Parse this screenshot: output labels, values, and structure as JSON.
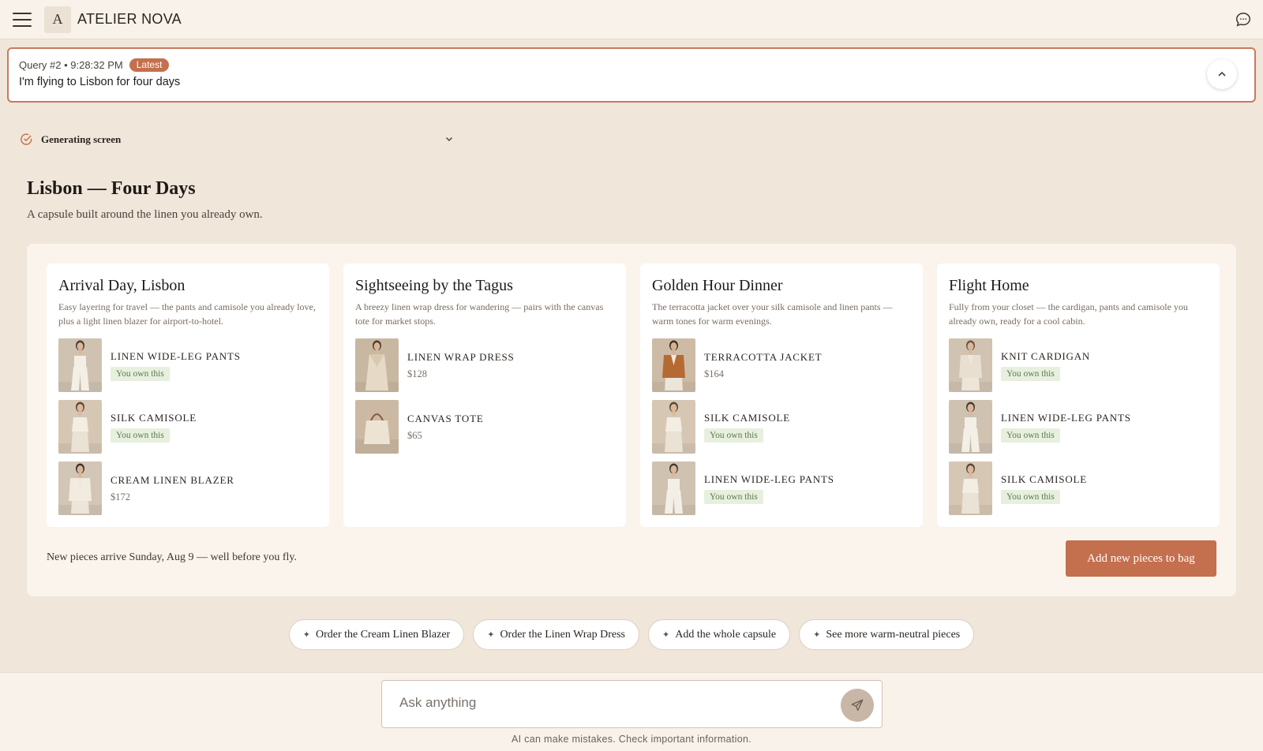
{
  "app": {
    "brand": "ATELIER NOVA",
    "logo_letter": "A"
  },
  "query": {
    "meta": "Query #2 • 9:28:32 PM",
    "badge": "Latest",
    "text": "I'm flying to Lisbon for four days"
  },
  "status": {
    "label": "Generating screen"
  },
  "page": {
    "title": "Lisbon — Four Days",
    "subtitle": "A capsule built around the linen you already own."
  },
  "days": [
    {
      "title": "Arrival Day, Lisbon",
      "description": "Easy layering for travel — the pants and camisole you already love, plus a light linen blazer for airport-to-hotel.",
      "items": [
        {
          "name": "LINEN WIDE-LEG PANTS",
          "owned": "You own this",
          "image": "pants"
        },
        {
          "name": "SILK CAMISOLE",
          "owned": "You own this",
          "image": "camisole"
        },
        {
          "name": "CREAM LINEN BLAZER",
          "price": "$172",
          "image": "blazer"
        }
      ]
    },
    {
      "title": "Sightseeing by the Tagus",
      "description": "A breezy linen wrap dress for wandering — pairs with the canvas tote for market stops.",
      "items": [
        {
          "name": "LINEN WRAP DRESS",
          "price": "$128",
          "image": "dress"
        },
        {
          "name": "CANVAS TOTE",
          "price": "$65",
          "image": "tote"
        }
      ]
    },
    {
      "title": "Golden Hour Dinner",
      "description": "The terracotta jacket over your silk camisole and linen pants — warm tones for warm evenings.",
      "items": [
        {
          "name": "TERRACOTTA JACKET",
          "price": "$164",
          "image": "jacket"
        },
        {
          "name": "SILK CAMISOLE",
          "owned": "You own this",
          "image": "camisole"
        },
        {
          "name": "LINEN WIDE-LEG PANTS",
          "owned": "You own this",
          "image": "pants"
        }
      ]
    },
    {
      "title": "Flight Home",
      "description": "Fully from your closet — the cardigan, pants and camisole you already own, ready for a cool cabin.",
      "items": [
        {
          "name": "KNIT CARDIGAN",
          "owned": "You own this",
          "image": "cardigan"
        },
        {
          "name": "LINEN WIDE-LEG PANTS",
          "owned": "You own this",
          "image": "pants"
        },
        {
          "name": "SILK CAMISOLE",
          "owned": "You own this",
          "image": "camisole"
        }
      ]
    }
  ],
  "footer_note": "New pieces arrive Sunday, Aug 9 — well before you fly.",
  "bag_button": "Add new pieces to bag",
  "suggestions": [
    "Order the Cream Linen Blazer",
    "Order the Linen Wrap Dress",
    "Add the whole capsule",
    "See more warm-neutral pieces"
  ],
  "composer": {
    "placeholder": "Ask anything",
    "disclaimer": "AI can make mistakes. Check important information."
  },
  "colors": {
    "accent": "#c46f4e",
    "background": "#f0e6da",
    "owned_tag_bg": "#e7f0de",
    "owned_tag_text": "#5d7a4e"
  },
  "icons": [
    "menu-icon",
    "chat-icon",
    "chevron-up-icon",
    "check-circle-icon",
    "chevron-down-icon",
    "sparkle-icon",
    "send-icon"
  ]
}
